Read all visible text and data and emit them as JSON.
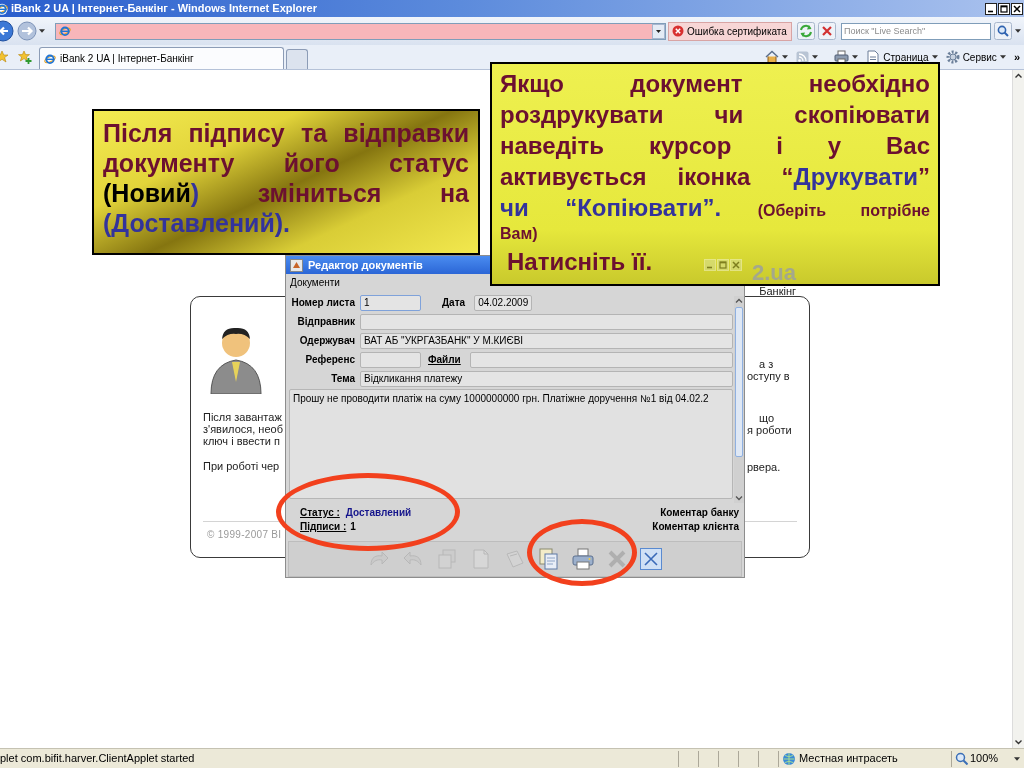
{
  "window": {
    "title": "iBank 2 UA | Інтернет-Банкінг - Windows Internet Explorer"
  },
  "address_bar": {
    "certificate_error": "Ошибка сертификата",
    "search": {
      "placeholder": "Поиск \"Live Search\""
    }
  },
  "tabs": [
    {
      "kind": "page",
      "label": "iBank 2 UA | Інтернет-Банкінг",
      "selected": true
    },
    {
      "kind": "new",
      "selected": false
    }
  ],
  "command_bar": {
    "items": [
      {
        "kind": "page",
        "label": "Страница"
      },
      {
        "kind": "tools",
        "label": "Сервис"
      }
    ],
    "overflow": "»"
  },
  "page": {
    "logo": "2.ua",
    "heading": "Банкінг",
    "left_text": [
      [
        "Після завантаж",
        "з'явилося, необ",
        "ключ і ввести п"
      ],
      [
        "При роботі чер"
      ]
    ],
    "right_text": [
      [
        "а з",
        "оступу в"
      ],
      [
        "що",
        "я роботи"
      ],
      [
        "рвера."
      ]
    ],
    "copyright": "© 1999-2007 BI"
  },
  "dialog": {
    "title": "Редактор документів",
    "menu": [
      "Документи"
    ],
    "form": [
      [
        {
          "kind": "short",
          "label": "Номер листа",
          "value": "1",
          "focused": true
        },
        {
          "kind": "date",
          "label": "Дата",
          "value": "04.02.2009",
          "focused": false
        }
      ],
      [
        {
          "kind": "wide",
          "label": "Відправник",
          "focused": false
        }
      ],
      [
        {
          "kind": "wide",
          "label": "Одержувач",
          "value": "ВАТ АБ \"УКРГАЗБАНК\" У М.КИЄВІ",
          "focused": false
        }
      ],
      [
        {
          "kind": "short",
          "label": "Референс",
          "focused": false
        },
        {
          "kind": "link",
          "label": "Файли",
          "focused": false
        }
      ],
      [
        {
          "kind": "wide",
          "label": "Тема",
          "value": "Відкликання платежу",
          "focused": false
        }
      ]
    ],
    "message": "Прошу не проводити платіж на суму 1000000000 грн. Платіжне доручення №1 від 04.02.2",
    "status": {
      "label": "Статус :",
      "value": "Доставлений"
    },
    "signatures": {
      "label": "Підписи :",
      "value": "1"
    },
    "comments": [
      "Коментар банку",
      "Коментар клієнта"
    ],
    "toolbar": [
      {
        "kind": "redo",
        "disabled": true
      },
      {
        "kind": "undo",
        "disabled": true
      },
      {
        "kind": "stack",
        "disabled": true
      },
      {
        "kind": "page",
        "disabled": true
      },
      {
        "kind": "sign",
        "disabled": true
      },
      {
        "kind": "copy",
        "disabled": false
      },
      {
        "kind": "print",
        "disabled": false
      },
      {
        "kind": "delete",
        "disabled": true
      },
      {
        "kind": "close",
        "disabled": false
      }
    ]
  },
  "callouts": [
    {
      "kind": "shaded",
      "paragraphs": [
        {
          "lines": [
            [
              {
                "kind": "plain",
                "text": "Після підпису та відправки "
              }
            ],
            [
              {
                "kind": "plain",
                "text": "документу його статус "
              }
            ],
            [
              {
                "kind": "contrast",
                "text": "(Новий"
              },
              {
                "kind": "accent",
                "text": ")"
              },
              {
                "kind": "plain",
                "text": " зміниться на "
              }
            ],
            [
              {
                "kind": "accent",
                "text": "(Доставлений)."
              }
            ]
          ]
        }
      ]
    },
    {
      "kind": "bright",
      "paragraphs": [
        {
          "lines": [
            [
              {
                "kind": "plain",
                "text": "Якщо документ необхідно "
              }
            ],
            [
              {
                "kind": "plain",
                "text": "роздрукувати чи скопіювати "
              }
            ],
            [
              {
                "kind": "plain",
                "text": "наведіть курсор і у Вас "
              }
            ],
            [
              {
                "kind": "plain",
                "text": "активується іконка “"
              },
              {
                "kind": "accent",
                "text": "Друкувати"
              },
              {
                "kind": "plain",
                "text": "” "
              }
            ],
            [
              {
                "kind": "accent",
                "text": "чи “Копіювати”. "
              },
              {
                "kind": "note",
                "text": "(Оберіть потрібне "
              }
            ],
            [
              {
                "kind": "note",
                "text": "Вам)"
              }
            ]
          ]
        },
        {
          "lines": [
            [
              {
                "kind": "plain",
                "text": "Натисніть її."
              }
            ]
          ]
        }
      ]
    }
  ],
  "status_bar": {
    "text": "plet com.bifit.harver.ClientApplet started",
    "zone": "Местная интрасеть",
    "zoom": "100%"
  }
}
